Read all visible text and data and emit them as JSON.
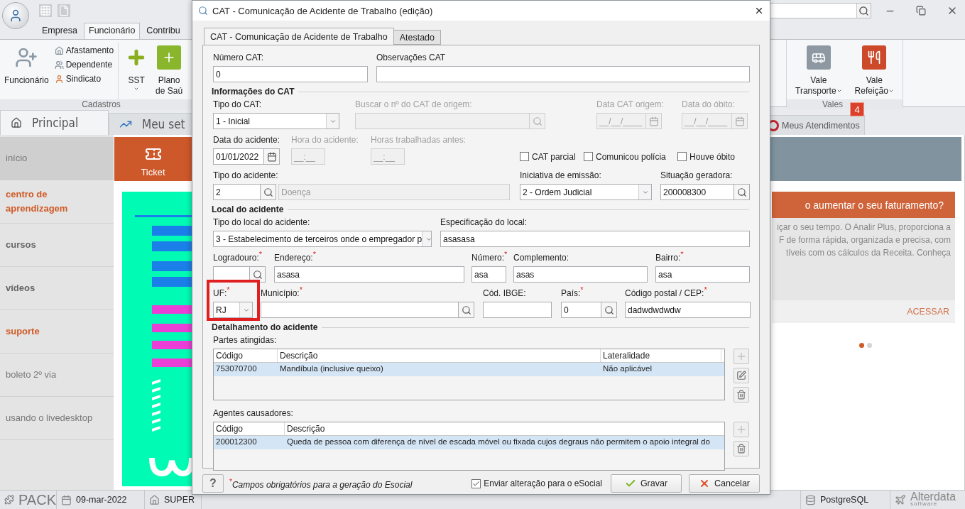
{
  "app": {
    "ribbon_tabs": [
      {
        "label": "Empresa",
        "selected": false
      },
      {
        "label": "Funcionário",
        "selected": true
      },
      {
        "label": "Contribu",
        "selected": false
      }
    ],
    "ribbon": {
      "big_button": "Funcionário",
      "small_buttons": [
        "Afastamento",
        "Dependente",
        "Sindicato"
      ],
      "sst_button": "SST",
      "plano_button": [
        "Plano",
        "de Saú"
      ],
      "group_label": "Cadastros",
      "vales": [
        {
          "lines": [
            "Vale",
            "Transporte"
          ],
          "kind": "bus"
        },
        {
          "lines": [
            "Vale",
            "Refeição"
          ],
          "kind": "meal"
        }
      ],
      "vales_label": "Vales"
    },
    "page_tabs": [
      {
        "label": "Principal",
        "selected": true,
        "kind": "home"
      },
      {
        "label": "Meu set",
        "selected": false,
        "kind": "chart"
      }
    ],
    "atendimentos_tab": {
      "label": "Meus Atendimentos",
      "badge": "4"
    },
    "sidebar": [
      {
        "label": "início",
        "kind": "plain",
        "selected": true
      },
      {
        "label": "centro de aprendizagem",
        "kind": "highlight",
        "selected": false
      },
      {
        "label": "cursos",
        "kind": "bold",
        "selected": false
      },
      {
        "label": "vídeos",
        "kind": "bold",
        "selected": false
      },
      {
        "label": "suporte",
        "kind": "highlight",
        "selected": false
      },
      {
        "label": "boleto 2º via",
        "kind": "plain",
        "selected": false
      },
      {
        "label": "usando o livedesktop",
        "kind": "plain",
        "selected": false
      }
    ],
    "ticket_tile": "Ticket",
    "promo": {
      "title": "o aumentar o seu faturamento?",
      "body_lines": [
        "içar o seu tempo. O Analir Plus, proporciona a",
        "F de forma rápida, organizada e precisa, com",
        "tíveis com os cálculos da Receita. Conheça"
      ],
      "action": "ACESSAR",
      "dots": [
        {
          "selected": true
        },
        {
          "selected": false
        }
      ]
    },
    "status_bar": {
      "pack": "PACK",
      "date": "09-mar-2022",
      "user": "SUPER",
      "database": "PostgreSQL",
      "logo": "Alterdata",
      "logo_sub": "software"
    }
  },
  "dialog": {
    "title": "CAT - Comunicação de Acidente de Trabalho (edição)",
    "required_mark": "*",
    "tabs": [
      {
        "label": "CAT - Comunicação de Acidente de Trabalho",
        "selected": true
      },
      {
        "label": "Atestado",
        "selected": false
      }
    ],
    "form": [
      {
        "kind": "row",
        "fields": [
          {
            "kind": "text",
            "label": "Número CAT:",
            "value": "0"
          },
          {
            "kind": "text",
            "label": "Observações CAT"
          }
        ]
      },
      {
        "kind": "section",
        "title": "Informações do CAT"
      },
      {
        "kind": "row",
        "fields": [
          {
            "kind": "combo",
            "label": "Tipo do CAT:",
            "value": "1 - Inicial"
          },
          {
            "kind": "search",
            "label": "Buscar o nº do CAT de origem:",
            "disabled": true
          },
          {
            "kind": "date",
            "label": "Data CAT origem:",
            "value": "__/__/____",
            "disabled": true
          },
          {
            "kind": "date",
            "label": "Data do óbito:",
            "value": "__/__/____",
            "disabled": true
          }
        ]
      },
      {
        "kind": "row",
        "fields": [
          {
            "kind": "date",
            "label": "Data do acidente:",
            "value": "01/01/2022"
          },
          {
            "kind": "text",
            "label": "Hora do acidente:",
            "value": "__:__",
            "disabled": true
          },
          {
            "kind": "text",
            "label": "Horas trabalhadas antes:",
            "value": "__:__",
            "disabled": true
          },
          {
            "kind": "checkbox",
            "label": "CAT parcial",
            "checked": false
          },
          {
            "kind": "checkbox",
            "label": "Comunicou polícia",
            "checked": false
          },
          {
            "kind": "checkbox",
            "label": "Houve óbito",
            "checked": false
          }
        ]
      },
      {
        "kind": "row",
        "fields": [
          {
            "kind": "lookup",
            "label": "Tipo do acidente:",
            "value": "2",
            "description": "Doença"
          },
          {
            "kind": "combo",
            "label": "Iniciativa de emissão:",
            "value": "2 - Ordem Judicial"
          },
          {
            "kind": "search",
            "label": "Situação geradora:",
            "value": "200008300"
          }
        ]
      },
      {
        "kind": "section",
        "title": "Local do acidente"
      },
      {
        "kind": "row",
        "fields": [
          {
            "kind": "combo",
            "label": "Tipo do local do acidente:",
            "value": "3 - Estabelecimento de terceiros onde o empregador p"
          },
          {
            "kind": "text",
            "label": "Especificação do local:",
            "value": "asasasa"
          }
        ]
      },
      {
        "kind": "row",
        "fields": [
          {
            "kind": "search",
            "label": "Logradouro:",
            "required": true
          },
          {
            "kind": "text",
            "label": "Endereço:",
            "value": "asasa",
            "required": true
          },
          {
            "kind": "text",
            "label": "Número:",
            "value": "asa",
            "required": true
          },
          {
            "kind": "text",
            "label": "Complemento:",
            "value": "asas"
          },
          {
            "kind": "text",
            "label": "Bairro:",
            "value": "asa",
            "required": true
          }
        ]
      },
      {
        "kind": "row",
        "fields": [
          {
            "kind": "combo",
            "label": "UF:",
            "value": "RJ",
            "required": true
          },
          {
            "kind": "search",
            "label": "Município:",
            "required": true
          },
          {
            "kind": "text",
            "label": "Cód. IBGE:"
          },
          {
            "kind": "search",
            "label": "País:",
            "value": "0",
            "required": true
          },
          {
            "kind": "text",
            "label": "Código postal / CEP:",
            "value": "dadwdwdwdw",
            "required": true
          }
        ]
      },
      {
        "kind": "section",
        "title": "Detalhamento do acidente"
      }
    ],
    "tables": [
      {
        "label": "Partes atingidas:",
        "columns": [
          "Código",
          "Descrição",
          "Lateralidade"
        ],
        "rows": [
          {
            "cells": [
              "753070700",
              "Mandíbula (inclusive queixo)",
              "Não aplicável"
            ],
            "selected": true
          }
        ],
        "buttons": [
          {
            "kind": "add",
            "disabled": true
          },
          {
            "kind": "edit",
            "disabled": false
          },
          {
            "kind": "delete",
            "disabled": false
          }
        ]
      },
      {
        "label": "Agentes causadores:",
        "columns": [
          "Código",
          "Descrição"
        ],
        "rows": [
          {
            "cells": [
              "200012300",
              "Queda de pessoa com diferença de nível de escada móvel ou fixada cujos degraus não permitem o apoio integral do"
            ],
            "selected": true
          }
        ],
        "buttons": [
          {
            "kind": "add",
            "disabled": true
          },
          {
            "kind": "delete",
            "disabled": false
          }
        ]
      }
    ],
    "footer": {
      "help": "?",
      "note": "Campos obrigatórios para a geração do Esocial",
      "send": {
        "label": "Enviar alteração para o eSocial",
        "checked": true
      },
      "buttons": [
        {
          "kind": "save",
          "label": "Gravar"
        },
        {
          "kind": "cancel",
          "label": "Cancelar"
        }
      ]
    },
    "highlight_box": true
  }
}
